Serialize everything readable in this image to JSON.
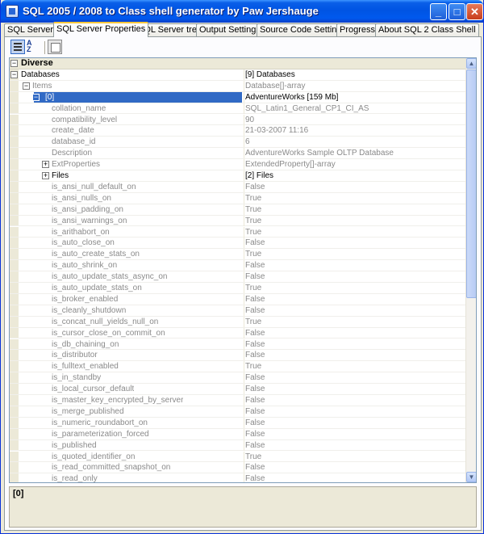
{
  "window": {
    "title": "SQL 2005 / 2008 to Class shell generator by Paw Jershauge",
    "minimize": "_",
    "maximize": "□",
    "close": "✕"
  },
  "tabs": [
    {
      "label": "SQL Server",
      "active": false
    },
    {
      "label": "SQL Server Properties",
      "active": true
    },
    {
      "label": "SQL Server tree",
      "active": false
    },
    {
      "label": "Output Settings",
      "active": false
    },
    {
      "label": "Source Code Settings",
      "active": false
    },
    {
      "label": "Progress",
      "active": false
    },
    {
      "label": "About SQL 2 Class Shell",
      "active": false
    }
  ],
  "toolbar": {
    "categorized_icon": "categorized-view-icon",
    "alphabetical_icon": "alphabetical-sort-icon",
    "alpha_top": "A",
    "alpha_bottom": "Z",
    "property_pages_icon": "property-pages-icon"
  },
  "grid": {
    "rows": [
      {
        "type": "category",
        "expander": "⊟",
        "name": "Diverse",
        "value": ""
      },
      {
        "type": "prop",
        "expander": "⊟",
        "name": "Databases",
        "value": "[9] Databases",
        "gray": false
      },
      {
        "type": "prop",
        "expander": "⊟",
        "name": "Items",
        "value": "Database[]-array",
        "gray": true
      },
      {
        "type": "selected",
        "expander": "⊟",
        "name": "[0]",
        "value": "AdventureWorks [159 Mb]",
        "gray": false
      },
      {
        "type": "prop",
        "name": "collation_name",
        "value": "SQL_Latin1_General_CP1_CI_AS",
        "gray": true
      },
      {
        "type": "prop",
        "name": "compatibility_level",
        "value": "90",
        "gray": true
      },
      {
        "type": "prop",
        "name": "create_date",
        "value": "21-03-2007 11:16",
        "gray": true
      },
      {
        "type": "prop",
        "name": "database_id",
        "value": "6",
        "gray": true
      },
      {
        "type": "prop",
        "name": "Description",
        "value": "AdventureWorks Sample OLTP Database",
        "gray": true
      },
      {
        "type": "prop",
        "expander": "⊞",
        "name": "ExtProperties",
        "value": "ExtendedProperty[]-array",
        "gray": true
      },
      {
        "type": "prop",
        "expander": "⊞",
        "name": "Files",
        "value": "[2] Files",
        "gray": false
      },
      {
        "type": "prop",
        "name": "is_ansi_null_default_on",
        "value": "False",
        "gray": true
      },
      {
        "type": "prop",
        "name": "is_ansi_nulls_on",
        "value": "True",
        "gray": true
      },
      {
        "type": "prop",
        "name": "is_ansi_padding_on",
        "value": "True",
        "gray": true
      },
      {
        "type": "prop",
        "name": "is_ansi_warnings_on",
        "value": "True",
        "gray": true
      },
      {
        "type": "prop",
        "name": "is_arithabort_on",
        "value": "True",
        "gray": true
      },
      {
        "type": "prop",
        "name": "is_auto_close_on",
        "value": "False",
        "gray": true
      },
      {
        "type": "prop",
        "name": "is_auto_create_stats_on",
        "value": "True",
        "gray": true
      },
      {
        "type": "prop",
        "name": "is_auto_shrink_on",
        "value": "False",
        "gray": true
      },
      {
        "type": "prop",
        "name": "is_auto_update_stats_async_on",
        "value": "False",
        "gray": true
      },
      {
        "type": "prop",
        "name": "is_auto_update_stats_on",
        "value": "True",
        "gray": true
      },
      {
        "type": "prop",
        "name": "is_broker_enabled",
        "value": "False",
        "gray": true
      },
      {
        "type": "prop",
        "name": "is_cleanly_shutdown",
        "value": "False",
        "gray": true
      },
      {
        "type": "prop",
        "name": "is_concat_null_yields_null_on",
        "value": "True",
        "gray": true
      },
      {
        "type": "prop",
        "name": "is_cursor_close_on_commit_on",
        "value": "False",
        "gray": true
      },
      {
        "type": "prop",
        "name": "is_db_chaining_on",
        "value": "False",
        "gray": true
      },
      {
        "type": "prop",
        "name": "is_distributor",
        "value": "False",
        "gray": true
      },
      {
        "type": "prop",
        "name": "is_fulltext_enabled",
        "value": "True",
        "gray": true
      },
      {
        "type": "prop",
        "name": "is_in_standby",
        "value": "False",
        "gray": true
      },
      {
        "type": "prop",
        "name": "is_local_cursor_default",
        "value": "False",
        "gray": true
      },
      {
        "type": "prop",
        "name": "is_master_key_encrypted_by_server",
        "value": "False",
        "gray": true
      },
      {
        "type": "prop",
        "name": "is_merge_published",
        "value": "False",
        "gray": true
      },
      {
        "type": "prop",
        "name": "is_numeric_roundabort_on",
        "value": "False",
        "gray": true
      },
      {
        "type": "prop",
        "name": "is_parameterization_forced",
        "value": "False",
        "gray": true
      },
      {
        "type": "prop",
        "name": "is_published",
        "value": "False",
        "gray": true
      },
      {
        "type": "prop",
        "name": "is_quoted_identifier_on",
        "value": "True",
        "gray": true
      },
      {
        "type": "prop",
        "name": "is_read_committed_snapshot_on",
        "value": "False",
        "gray": true
      },
      {
        "type": "prop",
        "name": "is_read_only",
        "value": "False",
        "gray": true
      }
    ]
  },
  "scrollbar": {
    "up": "▲",
    "down": "▼",
    "position": 0.0
  },
  "help": {
    "title": "[0]"
  }
}
